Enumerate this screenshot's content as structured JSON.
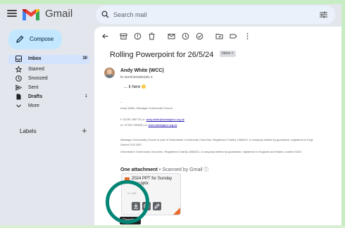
{
  "app": {
    "brand": "Gmail",
    "colors": {
      "accent": "#0b57d0",
      "compose_bg": "#c2e7ff",
      "highlight_ring": "#008575",
      "ppt_badge": "#e9692c"
    }
  },
  "header": {
    "search_placeholder": "Search mail"
  },
  "compose": {
    "label": "Compose"
  },
  "sidebar": {
    "items": [
      {
        "label": "Inbox",
        "count": "30",
        "icon": "inbox-icon"
      },
      {
        "label": "Starred",
        "count": "",
        "icon": "star-icon"
      },
      {
        "label": "Snoozed",
        "count": "",
        "icon": "clock-icon"
      },
      {
        "label": "Sent",
        "count": "",
        "icon": "send-icon"
      },
      {
        "label": "Drafts",
        "count": "1",
        "icon": "draft-icon"
      },
      {
        "label": "More",
        "count": "",
        "icon": "chevron-down-icon"
      }
    ],
    "labels_title": "Labels",
    "labels_add": "+"
  },
  "toolbar": {
    "icons": [
      "back-arrow-icon",
      "archive-icon",
      "report-spam-icon",
      "delete-icon",
      "mark-unread-icon",
      "snooze-icon",
      "add-task-icon",
      "move-to-icon",
      "label-icon",
      "more-vert-icon"
    ]
  },
  "email": {
    "subject": "Rolling Powerpoint for 26/5/24",
    "inbox_chip": "Inbox ×",
    "sender": "Andy White (WCC)",
    "to_line": "to servicematerials ▾",
    "body": "... it here",
    "signature": {
      "dashes": "--",
      "name_line": "Andy White, Wantage Community Church",
      "phone_line_prefix": "t: 01235 766770 | e:",
      "email_link": "andy.white@wantagecc.org.uk",
      "mobile_line_prefix": "m: 07765 705605 | w:",
      "web_link": "www.wantagecc.org.uk",
      "legal_1": "Wantage Community Church is part of Oxfordshire Community Churches. Registered Charity 1066021. A company limited by guarantee, registered in Engl",
      "legal_2": "Oxford OX2 0ES",
      "legal_3": "Oxfordshire Community Churches. Registered Charity 1066021. A company limited by guarantee, registered in England and Wales, number 0323"
    },
    "attachments": {
      "heading": "One attachment",
      "scan_note": " • Scanned by Gmail ⓘ",
      "file_name": "2024 PPT for Sunday May.pptx",
      "size": "6.0 MB",
      "tooltip": "Download"
    }
  }
}
